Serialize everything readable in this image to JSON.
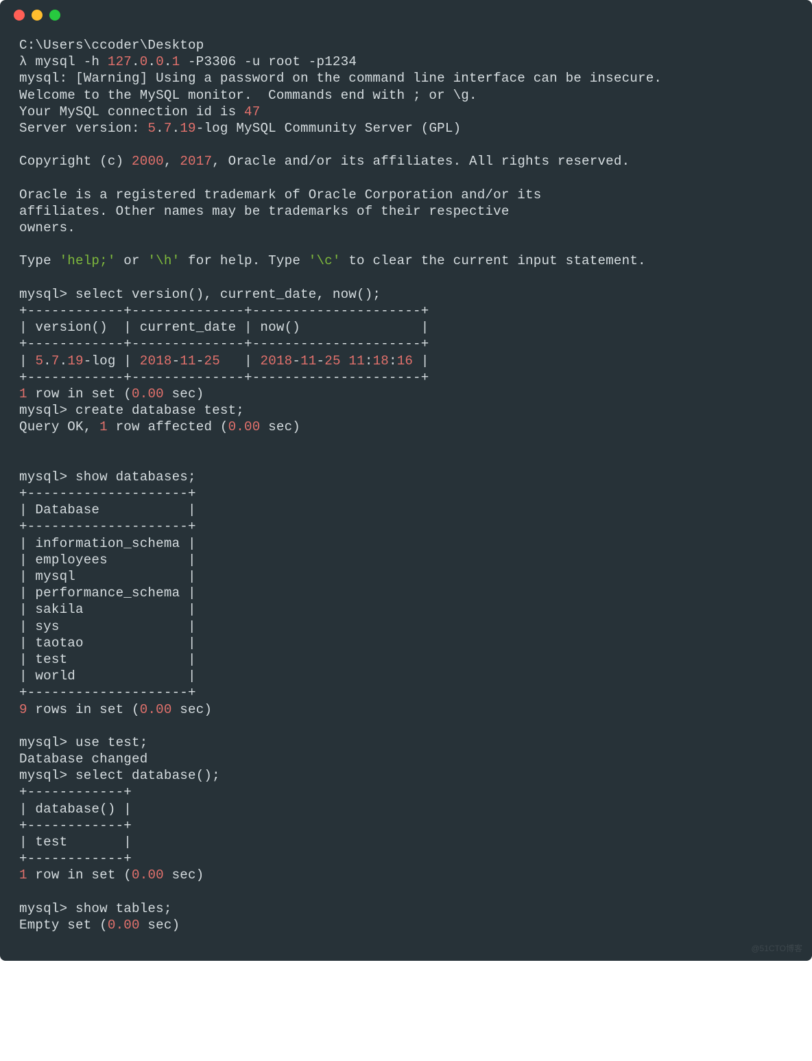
{
  "colors": {
    "bg": "#273238",
    "text": "#d6dde0",
    "accent_red": "#e2716c",
    "accent_green": "#7fb93c",
    "dot_red": "#ff5f56",
    "dot_yellow": "#ffbd2e",
    "dot_green": "#27c93f"
  },
  "session": {
    "cwd": "C:\\Users\\ccoder\\Desktop",
    "prompt_symbol": "λ",
    "launch_cmd_prefix": " mysql -h ",
    "host_ip": "127",
    "dot1": ".",
    "zero1": "0",
    "dot2": ".",
    "zero2": "0",
    "dot3": ".",
    "one": "1",
    "launch_cmd_suffix": " -P3306 -u root -p1234",
    "warning": "mysql: [Warning] Using a password on the command line interface can be insecure.",
    "welcome": "Welcome to the MySQL monitor.  Commands end with ; or \\g.",
    "conn_prefix": "Your MySQL connection id is ",
    "conn_id": "47",
    "server_prefix": "Server version: ",
    "sv_major": "5",
    "sv_d1": ".",
    "sv_minor": "7",
    "sv_d2": ".",
    "sv_patch": "19",
    "server_suffix": "-log MySQL Community Server (GPL)",
    "copyright_prefix": "Copyright (c) ",
    "cy1": "2000",
    "cy_comma": ", ",
    "cy2": "2017",
    "copyright_suffix": ", Oracle and/or its affiliates. All rights reserved.",
    "trademark1": "Oracle is a registered trademark of Oracle Corporation and/or its",
    "trademark2": "affiliates. Other names may be trademarks of their respective",
    "trademark3": "owners.",
    "help_prefix": "Type ",
    "help_lit": "'help;'",
    "help_or": " or ",
    "help_h": "'\\h'",
    "help_mid": " for help. Type ",
    "help_c": "'\\c'",
    "help_suffix": " to clear the current input statement."
  },
  "q1": {
    "prompt": "mysql> select version(), current_date, now();",
    "sep": "+------------+--------------+---------------------+",
    "hdr": "| version()  | current_date | now()               |",
    "row_open": "| ",
    "v_major": "5",
    "v_d1": ".",
    "v_minor": "7",
    "v_d2": ".",
    "v_patch": "19",
    "v_suffix": "-log | ",
    "d_y": "2018",
    "d_s1": "-",
    "d_m": "11",
    "d_s2": "-",
    "d_d": "25",
    "d_pad": "   | ",
    "n_y": "2018",
    "n_s1": "-",
    "n_m": "11",
    "n_s2": "-",
    "n_d": "25",
    "n_sp": " ",
    "n_h": "11",
    "n_c1": ":",
    "n_mi": "18",
    "n_c2": ":",
    "n_se": "16",
    "row_close": " |",
    "res_n": "1",
    "res_mid": " row in set (",
    "res_t": "0.00",
    "res_end": " sec)"
  },
  "q2": {
    "prompt": "mysql> create database test;",
    "ok_pre": "Query OK, ",
    "ok_n": "1",
    "ok_mid": " row affected (",
    "ok_t": "0.00",
    "ok_end": " sec)"
  },
  "q3": {
    "prompt": "mysql> show databases;",
    "sep": "+--------------------+",
    "hdr": "| Database           |",
    "rows": [
      "| information_schema |",
      "| employees          |",
      "| mysql              |",
      "| performance_schema |",
      "| sakila             |",
      "| sys                |",
      "| taotao             |",
      "| test               |",
      "| world              |"
    ],
    "res_n": "9",
    "res_mid": " rows in set (",
    "res_t": "0.00",
    "res_end": " sec)"
  },
  "q4": {
    "prompt": "mysql> use test;",
    "changed": "Database changed"
  },
  "q5": {
    "prompt": "mysql> select database();",
    "sep": "+------------+",
    "hdr": "| database() |",
    "row": "| test       |",
    "res_n": "1",
    "res_mid": " row in set (",
    "res_t": "0.00",
    "res_end": " sec)"
  },
  "q6": {
    "prompt": "mysql> show tables;",
    "empty_pre": "Empty set (",
    "empty_t": "0.00",
    "empty_end": " sec)"
  },
  "watermark": "@51CTO博客"
}
